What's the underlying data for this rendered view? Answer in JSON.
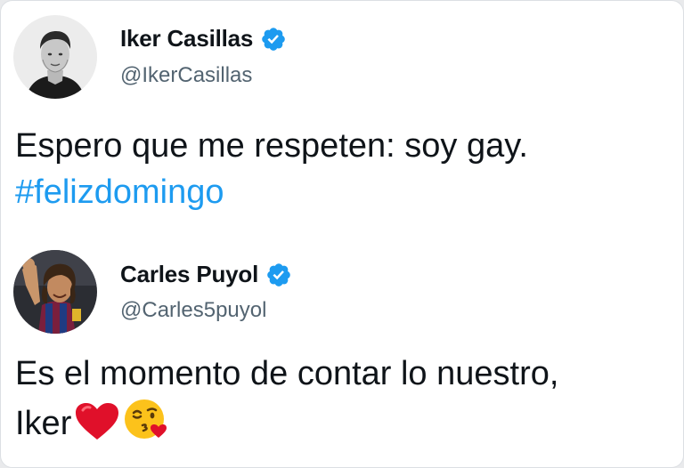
{
  "tweets": [
    {
      "author": {
        "display_name": "Iker Casillas",
        "handle": "@IkerCasillas",
        "verified": true,
        "avatar_icon": "avatar-iker-casillas"
      },
      "text_line1": "Espero que me respeten: soy gay.",
      "hashtag": "#felizdomingo"
    },
    {
      "author": {
        "display_name": "Carles Puyol",
        "handle": "@Carles5puyol",
        "verified": true,
        "avatar_icon": "avatar-carles-puyol"
      },
      "text_line1": "Es el momento de contar lo nuestro,",
      "text_line2": "Iker",
      "emojis": [
        "red-heart-icon",
        "face-blowing-kiss-icon"
      ]
    }
  ],
  "colors": {
    "link": "#1d9bf0",
    "verified": "#1d9bf0",
    "text": "#0f1419",
    "secondary_text": "#536471"
  }
}
